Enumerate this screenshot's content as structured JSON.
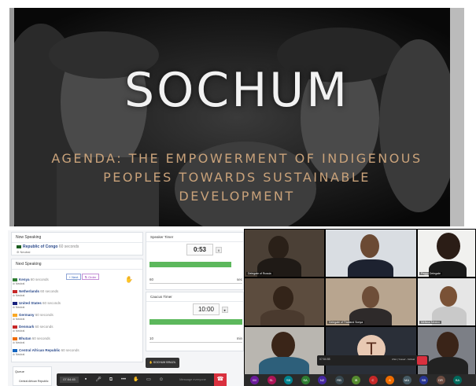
{
  "banner": {
    "title": "SOCHUM",
    "agenda_line1": "AGENDA: THE EMPOWERMENT OF INDIGENOUS",
    "agenda_line2": "PEOPLES TOWARDS SUSTAINABLE",
    "agenda_line3": "DEVELOPMENT"
  },
  "chair": {
    "now_speaking_title": "Now Speaking",
    "now_speaking_name": "Republic of Congo",
    "now_speaking_time": "60 seconds",
    "now_speaking_sub": "Neutral",
    "next_speaking_title": "Next Speaking",
    "next_button": "Next",
    "order_button": "Order",
    "speakers": [
      {
        "name": "Kenya",
        "time": "60 seconds",
        "flag": "#2e7d32"
      },
      {
        "name": "Netherlands",
        "time": "60 seconds",
        "flag": "#c62828"
      },
      {
        "name": "United States",
        "time": "60 seconds",
        "flag": "#1a237e"
      },
      {
        "name": "Germany",
        "time": "60 seconds",
        "flag": "#f9a825"
      },
      {
        "name": "Denmark",
        "time": "60 seconds",
        "flag": "#c62828"
      },
      {
        "name": "Bhutan",
        "time": "60 seconds",
        "flag": "#ef6c00"
      },
      {
        "name": "Central African Republic",
        "time": "60 seconds",
        "flag": "#1565c0"
      }
    ],
    "speaker_sub": "Neutral",
    "queue_label": "Queue",
    "queue_item": "Central African Republic"
  },
  "speaker_timer": {
    "title": "Speaker Timer",
    "value": "0:53",
    "field": "60",
    "unit": "sec",
    "progress": 0.88
  },
  "caucus_timer": {
    "title": "Caucus Timer",
    "value": "10:00",
    "field": "10",
    "unit": "min",
    "progress": 1.0
  },
  "zoom_bar": {
    "time": "07:54:45",
    "message_placeholder": "Message everyone",
    "reaction_label": "SOCHUM BRAZIL"
  },
  "video_tiles": [
    {
      "label": "Delegate of Russia"
    },
    {
      "label": ""
    },
    {
      "label": "Peggy Delegate"
    },
    {
      "label": ""
    },
    {
      "label": "Delegate of Thailand Sonya"
    },
    {
      "label": "Melissa Mexico"
    },
    {
      "label": ""
    },
    {
      "label": ""
    },
    {
      "label": ""
    }
  ],
  "mini_bar": {
    "time": "07:54:55",
    "label": "USA | Yossef - Kiribati"
  },
  "avatar_initial": "T",
  "avatars": [
    {
      "initials": "IM",
      "color": "#6a1b9a"
    },
    {
      "initials": "SL",
      "color": "#ad1457"
    },
    {
      "initials": "SB",
      "color": "#00838f"
    },
    {
      "initials": "SA",
      "color": "#2e7d32"
    },
    {
      "initials": "NZ",
      "color": "#4527a0"
    },
    {
      "initials": "RB",
      "color": "#37474f"
    },
    {
      "initials": "IB",
      "color": "#558b2f"
    },
    {
      "initials": "C",
      "color": "#c62828"
    },
    {
      "initials": "A",
      "color": "#ef6c00"
    },
    {
      "initials": "MA",
      "color": "#455a64"
    },
    {
      "initials": "SB",
      "color": "#283593"
    },
    {
      "initials": "DR",
      "color": "#6d4c41"
    },
    {
      "initials": "BA",
      "color": "#00695c"
    }
  ]
}
